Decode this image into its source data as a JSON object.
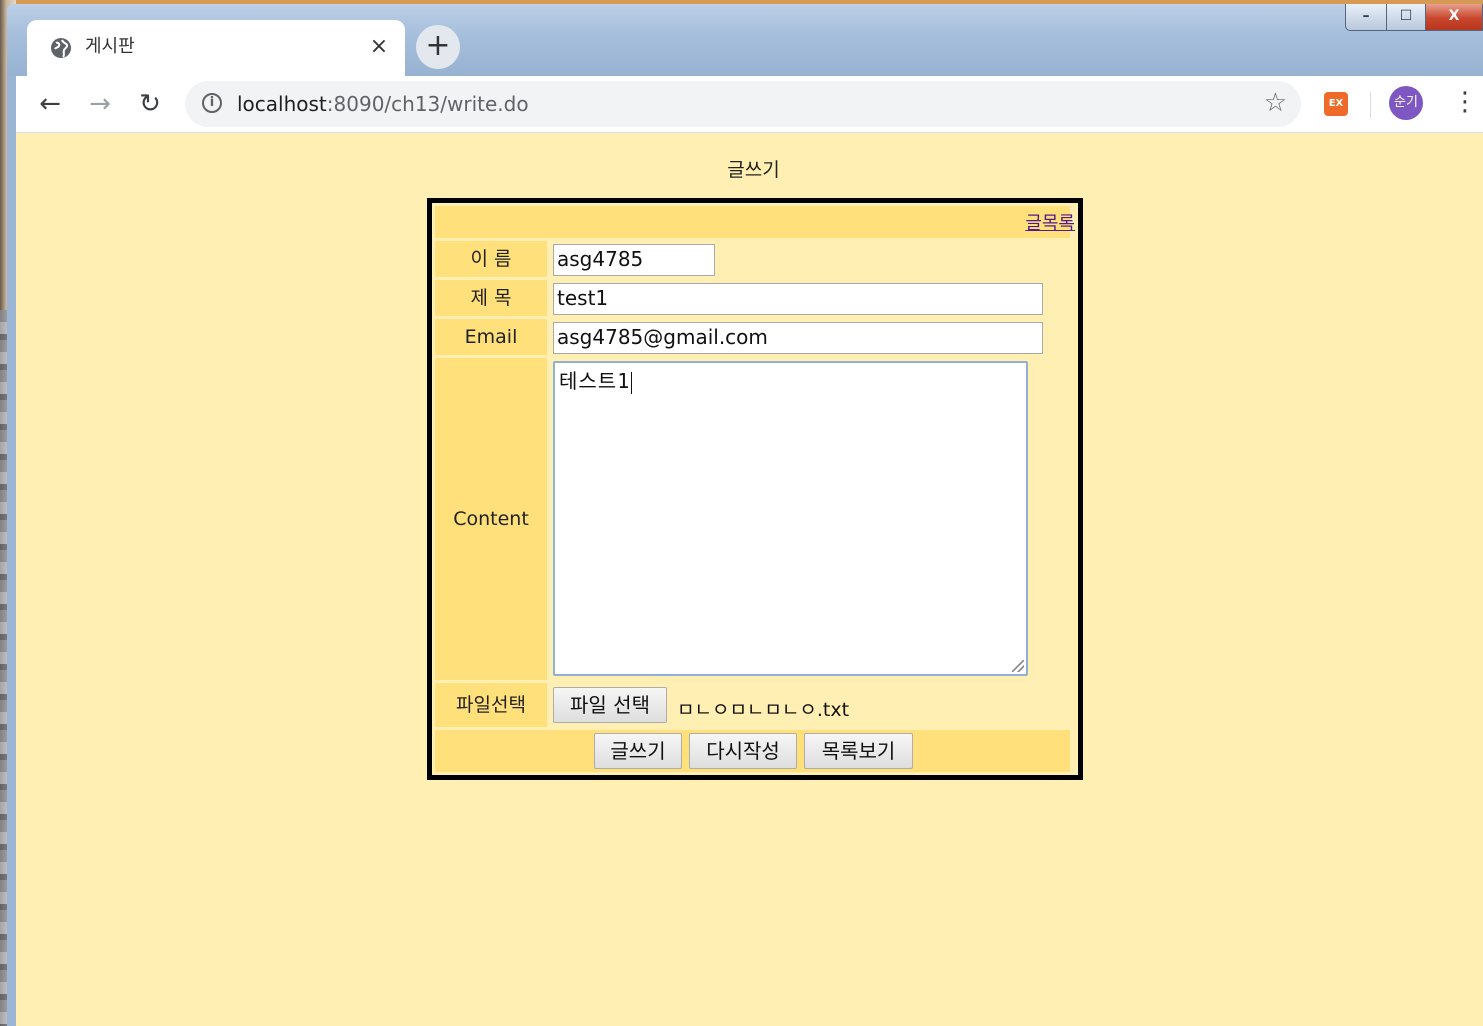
{
  "browser": {
    "tab": {
      "title": "게시판",
      "close_label": "×",
      "icon": "globe-icon"
    },
    "new_tab_label": "+",
    "window_controls": {
      "minimize": "–",
      "maximize": "☐",
      "close": "X"
    },
    "nav": {
      "back": "←",
      "forward": "→",
      "reload": "↻"
    },
    "address_bar": {
      "info_icon": "i",
      "host": "localhost",
      "rest": ":8090/ch13/write.do"
    },
    "bookmark_icon": "☆",
    "extension_label": "EX",
    "profile_label": "순기",
    "menu_icon": "⋮"
  },
  "page": {
    "title": "글쓰기",
    "list_link": "글목록",
    "form": {
      "name_label": "이 름",
      "name_value": "asg4785",
      "subject_label": "제 목",
      "subject_value": "test1",
      "email_label": "Email",
      "email_value": "asg4785@gmail.com",
      "content_label": "Content",
      "content_value": "테스트1",
      "file_label": "파일선택",
      "file_button": "파일 선택",
      "file_name": "ㅁㄴㅇㅁㄴㅁㄴㅇ.txt"
    },
    "buttons": {
      "submit": "글쓰기",
      "reset": "다시작성",
      "list": "목록보기"
    }
  },
  "colors": {
    "page_bg": "#ffefb3",
    "label_bg": "#ffe07a",
    "link": "#551a8b"
  }
}
